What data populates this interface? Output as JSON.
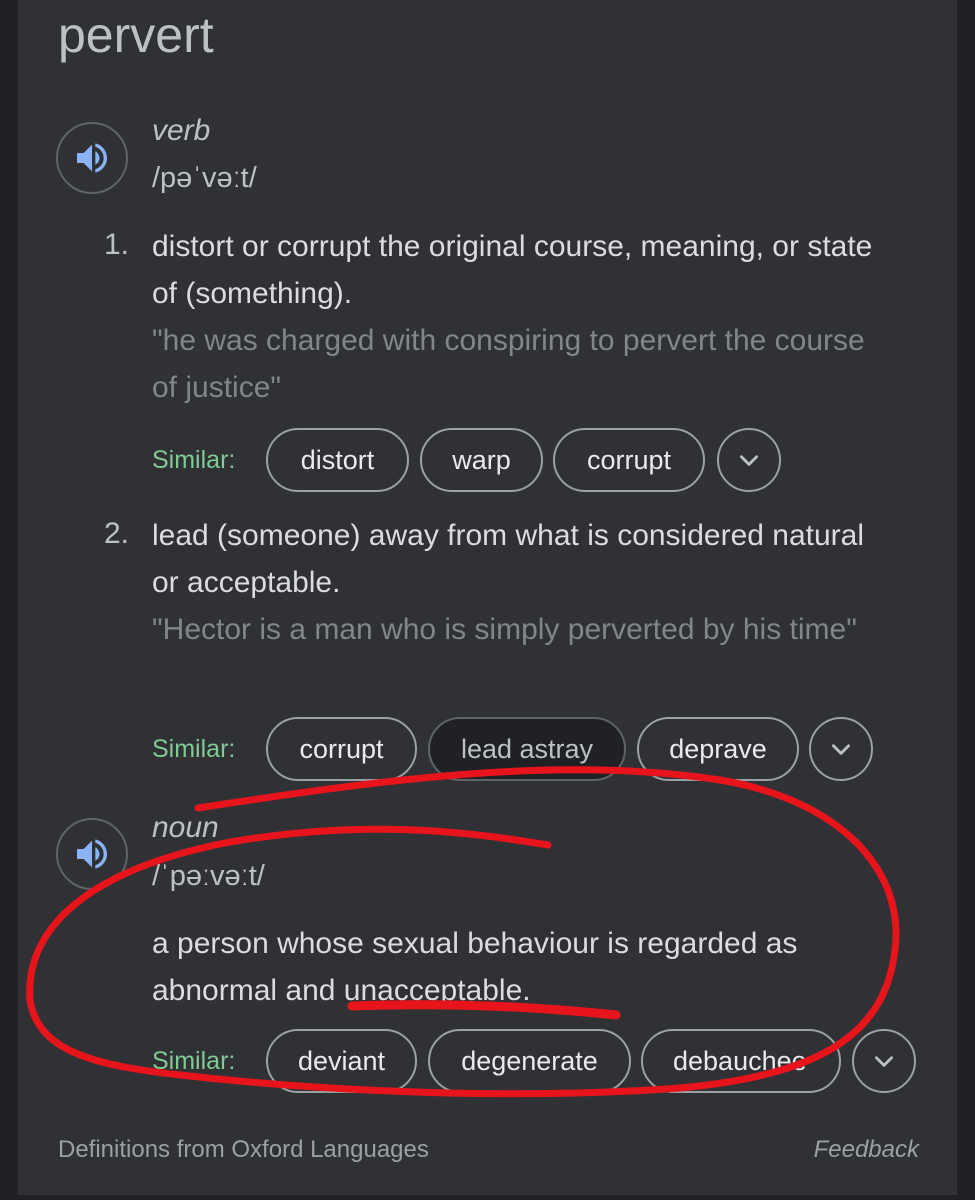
{
  "word": "pervert",
  "entries": [
    {
      "part_of_speech": "verb",
      "pronunciation": "/pəˈvəːt/",
      "senses": [
        {
          "number": "1.",
          "definition": "distort or corrupt the original course, meaning, or state of (something).",
          "example": "\"he was charged with conspiring to pervert the course of justice\"",
          "similar_label": "Similar:",
          "similar": [
            "distort",
            "warp",
            "corrupt"
          ]
        },
        {
          "number": "2.",
          "definition": "lead (someone) away from what is considered natural or acceptable.",
          "example": "\"Hector is a man who is simply perverted by his time\"",
          "similar_label": "Similar:",
          "similar": [
            "corrupt",
            "lead astray",
            "deprave"
          ]
        }
      ]
    },
    {
      "part_of_speech": "noun",
      "pronunciation": "/ˈpəːvəːt/",
      "senses": [
        {
          "definition": "a person whose sexual behaviour is regarded as abnormal and unacceptable.",
          "similar_label": "Similar:",
          "similar": [
            "deviant",
            "degenerate",
            "debauchee"
          ]
        }
      ]
    }
  ],
  "footer": {
    "source": "Definitions from Oxford Languages",
    "feedback": "Feedback"
  },
  "icons": {
    "speaker": "speaker-icon",
    "expand": "chevron-down-icon"
  },
  "colors": {
    "background": "#303134",
    "similar_label": "#81c995",
    "speaker_icon": "#8ab4f8",
    "annotation": "#e8141c"
  }
}
